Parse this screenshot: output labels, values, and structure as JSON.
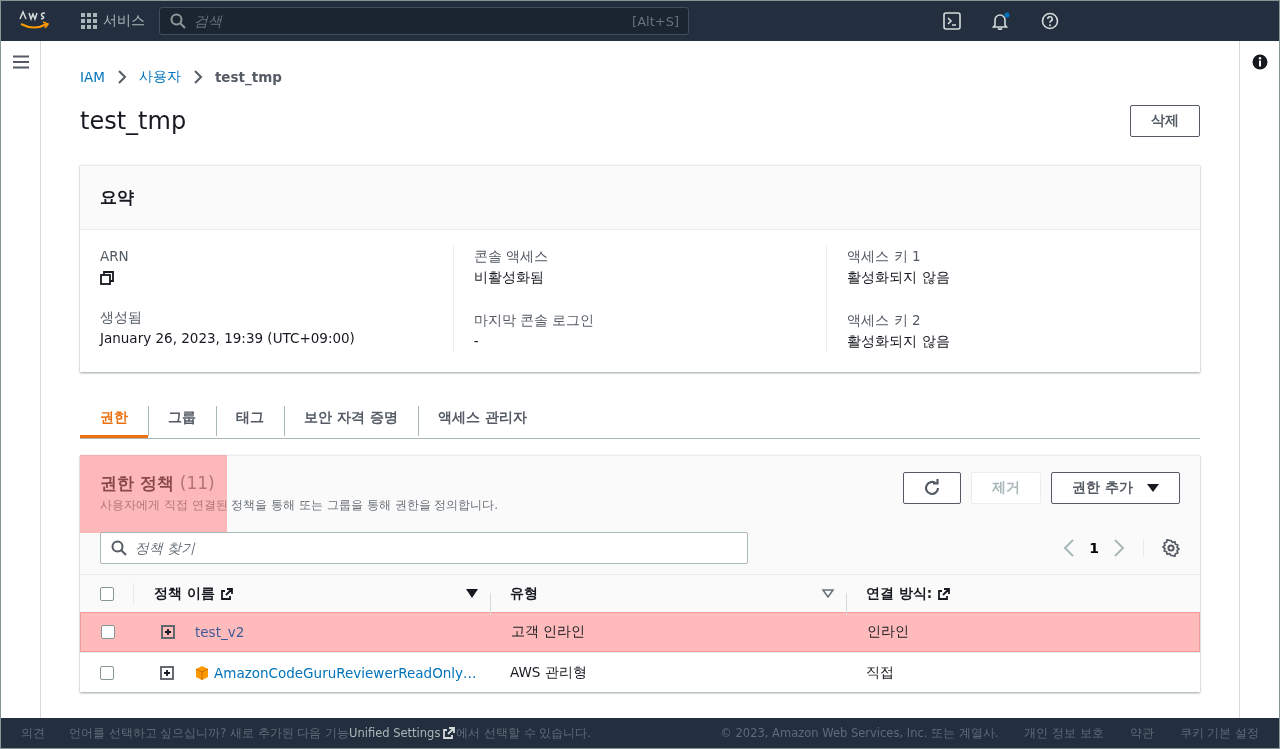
{
  "top_nav": {
    "services": "서비스",
    "search": {
      "placeholder": "검색",
      "shortcut": "[Alt+S]"
    },
    "notification_dot": true
  },
  "breadcrumbs": [
    {
      "label": "IAM",
      "link": true
    },
    {
      "label": "사용자",
      "link": true
    },
    {
      "label": "test_tmp",
      "link": false
    }
  ],
  "page_title": "test_tmp",
  "delete_button": "삭제",
  "summary": {
    "title": "요약",
    "columns": [
      [
        {
          "label": "ARN",
          "kind": "copy"
        },
        {
          "label": "생성됨",
          "value": "January 26, 2023, 19:39 (UTC+09:00)",
          "kind": "text"
        }
      ],
      [
        {
          "label": "콘솔 액세스",
          "value": "비활성화됨",
          "kind": "text"
        },
        {
          "label": "마지막 콘솔 로그인",
          "value": "-",
          "kind": "text"
        }
      ],
      [
        {
          "label": "액세스 키 1",
          "value": "활성화되지 않음",
          "kind": "text"
        },
        {
          "label": "액세스 키 2",
          "value": "활성화되지 않음",
          "kind": "text"
        }
      ]
    ]
  },
  "tabs": [
    {
      "label": "권한",
      "selected": true
    },
    {
      "label": "그룹",
      "selected": false
    },
    {
      "label": "태그",
      "selected": false
    },
    {
      "label": "보안 자격 증명",
      "selected": false
    },
    {
      "label": "액세스 관리자",
      "selected": false
    }
  ],
  "policies": {
    "title": "권한 정책",
    "count": "(11)",
    "title_highlighted": true,
    "description": "사용자에게 직접 연결된 정책을 통해 또는 그룹을 통해 권한을 정의합니다.",
    "buttons": [
      {
        "kind": "refresh",
        "disabled": false
      },
      {
        "kind": "text",
        "label": "제거",
        "disabled": true
      },
      {
        "kind": "dropdown",
        "label": "권한 추가",
        "disabled": false
      }
    ],
    "search": {
      "placeholder": "정책 찾기"
    },
    "page": "1",
    "select_all_checked": false,
    "columns": [
      {
        "label": "정책 이름",
        "external": true,
        "sortable": true,
        "sorted": true
      },
      {
        "label": "유형",
        "external": false,
        "sortable": true,
        "sorted": false
      },
      {
        "label": "연결 방식:",
        "external": true,
        "sortable": false
      }
    ],
    "rows": [
      {
        "checked": false,
        "name": "test_v2",
        "aws_managed": false,
        "type": "고객 인라인",
        "attached": "인라인",
        "highlighted": true
      },
      {
        "checked": false,
        "name": "AmazonCodeGuruReviewerReadOnly…",
        "aws_managed": true,
        "type": "AWS 관리형",
        "attached": "직접",
        "highlighted": false
      }
    ]
  },
  "footer": {
    "feedback": "의견",
    "lang_before": "언어를 선택하고 싶으십니까? 새로 추가된 다음 기능",
    "lang_link": "Unified Settings",
    "lang_after": "에서 선택할 수 있습니다.",
    "copyright": "© 2023, Amazon Web Services, Inc. 또는 계열사.",
    "links": [
      "개인 정보 보호",
      "약관",
      "쿠키 기본 설정"
    ]
  }
}
